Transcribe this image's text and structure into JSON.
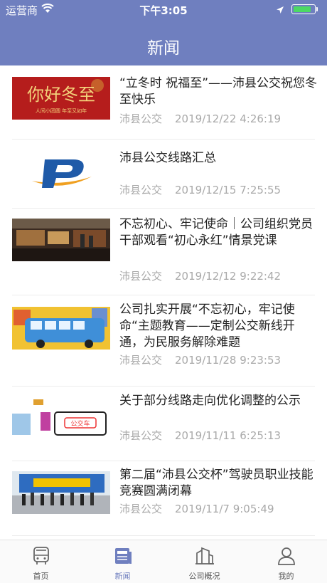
{
  "status_bar": {
    "carrier": "运营商",
    "time": "下午3:05",
    "battery_level": 0.9,
    "battery_color": "#4cd964"
  },
  "nav": {
    "title": "新闻",
    "background": "#6f7fbf"
  },
  "news": [
    {
      "title": "“立冬时 祝福至”——沛县公交祝您冬至快乐",
      "source": "沛县公交",
      "date": "2019/12/22 4:26:19",
      "thumb": "winter-solstice-banner",
      "thumb_text": "你好冬至",
      "thumb_subtext": "人间小团圆 年至又如年"
    },
    {
      "title": "沛县公交线路汇总",
      "source": "沛县公交",
      "date": "2019/12/15 7:25:55",
      "thumb": "p-logo"
    },
    {
      "title": "不忘初心、牢记使命｜公司组织党员干部观看“初心永红”情景党课",
      "source": "沛县公交",
      "date": "2019/12/12 9:22:42",
      "thumb": "exhibition-hall-photo"
    },
    {
      "title": "公司扎实开展“不忘初心，牢记使命“主题教育——定制公交新线开通，为民服务解除难题",
      "source": "沛县公交",
      "date": "2019/11/28 9:23:53",
      "thumb": "bus-cartoon"
    },
    {
      "title": "关于部分线路走向优化调整的公示",
      "source": "沛县公交",
      "date": "2019/11/11 6:25:13",
      "thumb": "bus-stop-cartoon",
      "thumb_text": "公交车"
    },
    {
      "title": "第二届“沛县公交杯”驾驶员职业技能竞赛圆满闭幕",
      "source": "沛县公交",
      "date": "2019/11/7 9:05:49",
      "thumb": "group-photo"
    }
  ],
  "tabs": [
    {
      "label": "首页",
      "icon": "bus-icon",
      "active": false
    },
    {
      "label": "新闻",
      "icon": "news-icon",
      "active": true
    },
    {
      "label": "公司概况",
      "icon": "building-icon",
      "active": false
    },
    {
      "label": "我的",
      "icon": "user-icon",
      "active": false
    }
  ]
}
